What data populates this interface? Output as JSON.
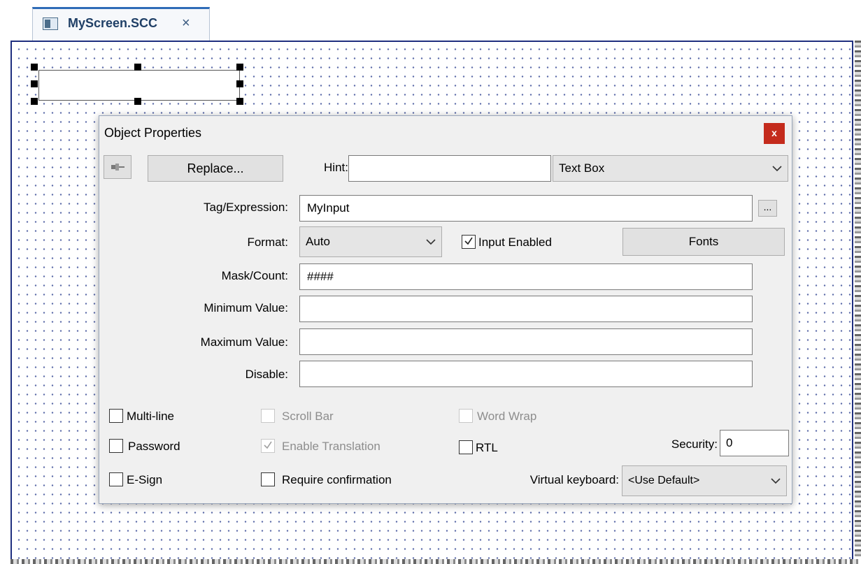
{
  "tab": {
    "title": "MyScreen.SCC",
    "close": "×"
  },
  "dialog": {
    "title": "Object Properties",
    "close": "x",
    "replace_label": "Replace...",
    "hint_label": "Hint:",
    "hint_value": "",
    "object_type": "Text Box",
    "tag_label": "Tag/Expression:",
    "tag_value": "MyInput",
    "browse_label": "...",
    "format_label": "Format:",
    "format_value": "Auto",
    "input_enabled_label": "Input Enabled",
    "input_enabled_checked": true,
    "fonts_label": "Fonts",
    "mask_label": "Mask/Count:",
    "mask_value": "####",
    "min_label": "Minimum Value:",
    "min_value": "",
    "max_label": "Maximum Value:",
    "max_value": "",
    "disable_label": "Disable:",
    "disable_value": "",
    "multiline_label": "Multi-line",
    "scrollbar_label": "Scroll Bar",
    "wordwrap_label": "Word Wrap",
    "password_label": "Password",
    "translation_label": "Enable Translation",
    "rtl_label": "RTL",
    "security_label": "Security:",
    "security_value": "0",
    "esign_label": "E-Sign",
    "confirm_label": "Require confirmation",
    "vkeyboard_label": "Virtual keyboard:",
    "vkeyboard_value": "<Use Default>"
  },
  "colors": {
    "close_red": "#c42b1c",
    "tab_accent": "#2f6cb8",
    "canvas_border": "#1f2f80"
  },
  "icons": [
    "screen-icon",
    "close-icon",
    "pin-icon",
    "chevron-down-icon",
    "checkmark-icon"
  ]
}
